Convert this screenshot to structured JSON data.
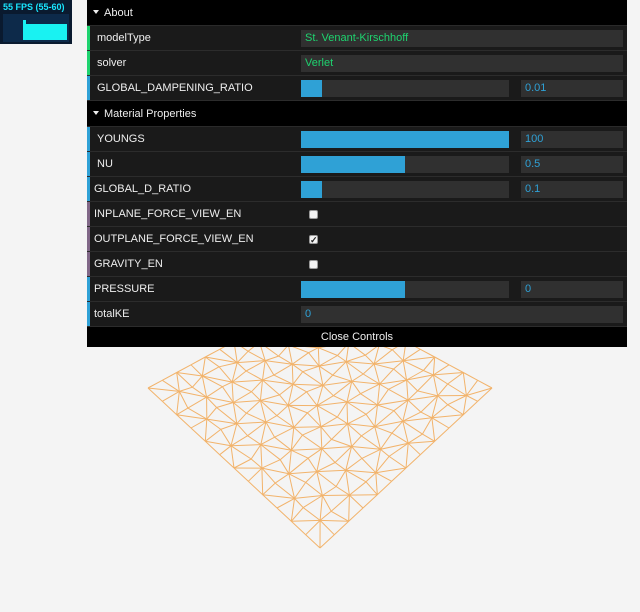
{
  "stats": {
    "fps_text": "55 FPS (55-60)"
  },
  "gui": {
    "about_folder": "About",
    "model_type": {
      "label": "modelType",
      "value": "St. Venant-Kirschhoff"
    },
    "solver": {
      "label": "solver",
      "value": "Verlet"
    },
    "global_dampening_ratio": {
      "label": "GLOBAL_DAMPENING_RATIO",
      "value": "0.01",
      "fraction": 0.1
    },
    "material_folder": "Material Properties",
    "youngs": {
      "label": "YOUNGS",
      "value": "100",
      "fraction": 1.0
    },
    "nu": {
      "label": "NU",
      "value": "0.5",
      "fraction": 0.5
    },
    "global_d_ratio": {
      "label": "GLOBAL_D_RATIO",
      "value": "0.1",
      "fraction": 0.1
    },
    "inplane_force_view_en": {
      "label": "INPLANE_FORCE_VIEW_EN",
      "checked": false
    },
    "outplane_force_view_en": {
      "label": "OUTPLANE_FORCE_VIEW_EN",
      "checked": true
    },
    "gravity_en": {
      "label": "GRAVITY_EN",
      "checked": false
    },
    "pressure": {
      "label": "PRESSURE",
      "value": "0",
      "fraction": 0.5
    },
    "total_ke": {
      "label": "totalKE",
      "value": "0"
    },
    "close_label": "Close Controls"
  },
  "colors": {
    "mesh": "#f2b36b",
    "accent_blue": "#2fa1d6",
    "accent_green": "#1ed36f",
    "panel_bg": "#1a1a1a"
  }
}
